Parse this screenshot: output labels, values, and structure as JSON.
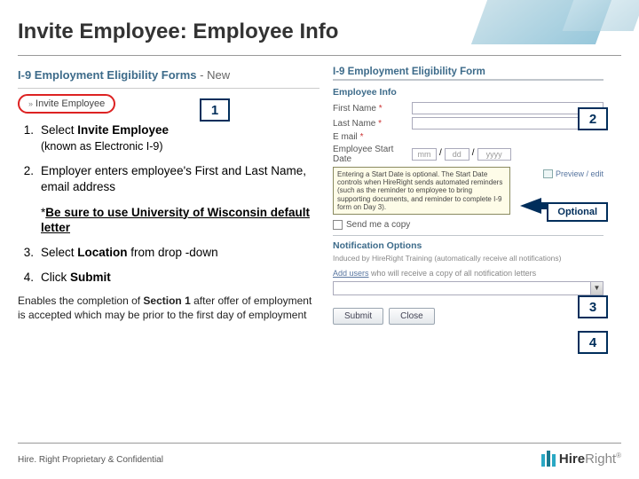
{
  "title": "Invite Employee: Employee Info",
  "nav": {
    "header": "I-9 Employment Eligibility Forms",
    "new": "- New",
    "invite_item": "Invite Employee",
    "arrow": "»"
  },
  "callouts": {
    "c1": "1",
    "c2": "2",
    "c3": "3",
    "c4": "4",
    "optional": "Optional"
  },
  "steps": [
    {
      "num": "1.",
      "text_pre": "Select ",
      "text_bold": "Invite Employee",
      "sub": "(known as Electronic I-9)"
    },
    {
      "num": "2.",
      "text": "Employer enters employee's First and Last Name, email address"
    },
    {
      "num": "3.",
      "text_pre": "Select ",
      "text_bold": "Location",
      "text_post": " from drop -down"
    },
    {
      "num": "4.",
      "text_pre": "Click ",
      "text_bold": "Submit"
    }
  ],
  "note": {
    "pre": "*",
    "underlined": "Be sure to use University of Wisconsin default letter"
  },
  "enable": {
    "pre": "Enables the completion of ",
    "bold": "Section 1",
    "post": " after offer of employment is accepted which may be prior to the first day of employment"
  },
  "form": {
    "header": "I-9 Employment Eligibility Form",
    "section_emp": "Employee Info",
    "first_name": "First Name",
    "last_name": "Last Name",
    "email": "E mail",
    "start_date": "Employee Start Date",
    "date_mm": "mm",
    "date_dd": "dd",
    "date_yyyy": "yyyy",
    "tooltip": "Entering a Start Date is optional. The Start Date controls when HireRight sends automated reminders (such as the reminder to employee to bring supporting documents, and reminder to complete I-9 form on Day 3).",
    "preview": "Preview / edit",
    "send_copy": "Send me a copy",
    "section_notif": "Notification Options",
    "notif_text": "Induced by HireRight Training (automatically receive all notifications)",
    "addusers": "Add users",
    "addusers_desc": " who will receive a copy of all notification letters",
    "submit": "Submit",
    "close": "Close",
    "asterisk": "*"
  },
  "footer": {
    "confidential": "Hire. Right Proprietary & Confidential",
    "logo_hire": "Hire",
    "logo_right": "Right",
    "reg": "®"
  }
}
